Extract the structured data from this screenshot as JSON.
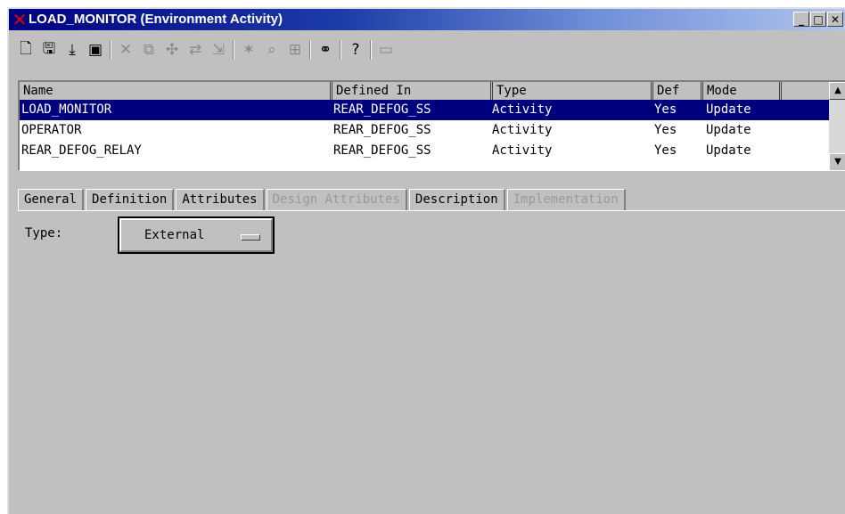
{
  "window": {
    "title": "LOAD_MONITOR (Environment Activity)",
    "app_icon": "x-logo-icon",
    "controls": [
      "minimize",
      "maximize",
      "close"
    ]
  },
  "toolbar": {
    "groups": [
      [
        "new-document-icon",
        "save-icon",
        "save-down-icon",
        "open-folder-icon"
      ],
      [
        "cut-icon",
        "copy-icon",
        "check-icon",
        "link-icon",
        "move-icon"
      ],
      [
        "connect-icon",
        "find-icon",
        "properties-icon"
      ],
      [
        "binoculars-icon"
      ],
      [
        "help-icon"
      ],
      [
        "screen-icon"
      ]
    ]
  },
  "table": {
    "columns": [
      "Name",
      "Defined In",
      "Type",
      "Def",
      "Mode"
    ],
    "rows": [
      {
        "name": "LOAD_MONITOR",
        "defined_in": "REAR_DEFOG_SS",
        "type": "Activity",
        "def": "Yes",
        "mode": "Update",
        "selected": true
      },
      {
        "name": "OPERATOR",
        "defined_in": "REAR_DEFOG_SS",
        "type": "Activity",
        "def": "Yes",
        "mode": "Update",
        "selected": false
      },
      {
        "name": "REAR_DEFOG_RELAY",
        "defined_in": "REAR_DEFOG_SS",
        "type": "Activity",
        "def": "Yes",
        "mode": "Update",
        "selected": false
      }
    ]
  },
  "tabs": [
    {
      "label": "General",
      "enabled": true,
      "active": false
    },
    {
      "label": "Definition",
      "enabled": true,
      "active": true
    },
    {
      "label": "Attributes",
      "enabled": true,
      "active": false
    },
    {
      "label": "Design Attributes",
      "enabled": false,
      "active": false
    },
    {
      "label": "Description",
      "enabled": true,
      "active": false
    },
    {
      "label": "Implementation",
      "enabled": false,
      "active": false
    }
  ],
  "definition": {
    "type_label": "Type:",
    "type_value": "External"
  },
  "colors": {
    "selection": "#00007f",
    "title_start": "#00007f",
    "title_end": "#b0c4ee",
    "logo": "#e00000"
  }
}
